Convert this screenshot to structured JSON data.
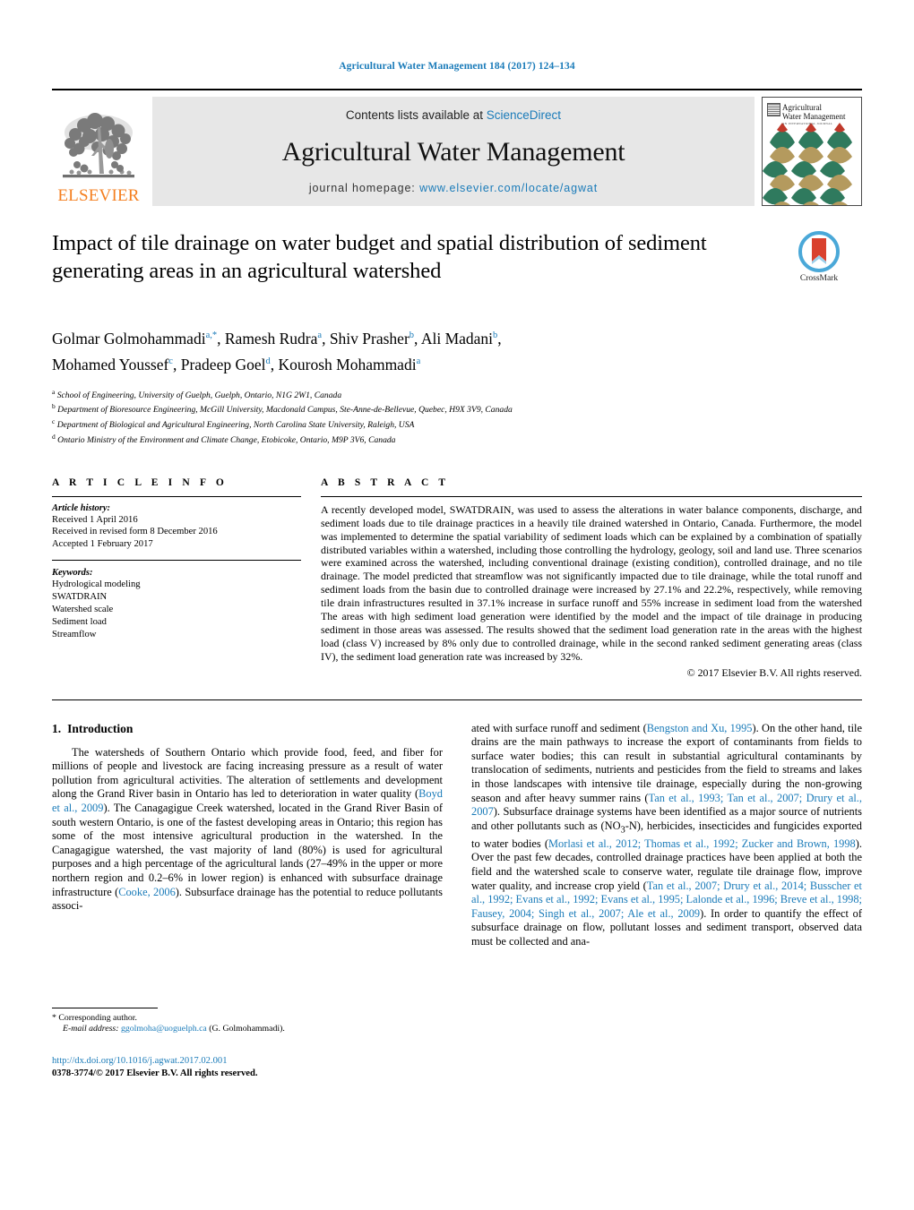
{
  "running_head": "Agricultural Water Management 184 (2017) 124–134",
  "masthead": {
    "elsevier_wordmark": "ELSEVIER",
    "contents_prefix": "Contents lists available at",
    "contents_link": "ScienceDirect",
    "journal_name": "Agricultural Water Management",
    "homepage_prefix": "journal homepage:",
    "homepage_link": "www.elsevier.com/locate/agwat",
    "cover_title_line1": "Agricultural",
    "cover_title_line2": "Water Management",
    "cover_subtitle": "AN INTERNATIONAL JOURNAL"
  },
  "article": {
    "title": "Impact of tile drainage on water budget and spatial distribution of sediment generating areas in an agricultural watershed",
    "crossmark_label": "CrossMark",
    "authors_line1_parts": [
      {
        "name": "Golmar Golmohammadi",
        "sup": "a,*"
      },
      {
        "name": "Ramesh Rudra",
        "sup": "a"
      },
      {
        "name": "Shiv Prasher",
        "sup": "b"
      },
      {
        "name": "Ali Madani",
        "sup": "b"
      }
    ],
    "authors_line2_parts": [
      {
        "name": "Mohamed Youssef",
        "sup": "c"
      },
      {
        "name": "Pradeep Goel",
        "sup": "d"
      },
      {
        "name": "Kourosh Mohammadi",
        "sup": "a"
      }
    ],
    "affiliations": [
      {
        "marker": "a",
        "text": "School of Engineering, University of Guelph, Guelph, Ontario, N1G 2W1, Canada"
      },
      {
        "marker": "b",
        "text": "Department of Bioresource Engineering, McGill University, Macdonald Campus, Ste-Anne-de-Bellevue, Quebec, H9X 3V9, Canada"
      },
      {
        "marker": "c",
        "text": "Department of Biological and Agricultural Engineering, North Carolina State University, Raleigh, USA"
      },
      {
        "marker": "d",
        "text": "Ontario Ministry of the Environment and Climate Change, Etobicoke, Ontario, M9P 3V6, Canada"
      }
    ]
  },
  "article_info": {
    "heading": "A R T I C L E    I N F O",
    "history_label": "Article history:",
    "history": [
      "Received 1 April 2016",
      "Received in revised form 8 December 2016",
      "Accepted 1 February 2017"
    ],
    "keywords_label": "Keywords:",
    "keywords": [
      "Hydrological modeling",
      "SWATDRAIN",
      "Watershed scale",
      "Sediment load",
      "Streamflow"
    ]
  },
  "abstract": {
    "heading": "A B S T R A C T",
    "text": "A recently developed model, SWATDRAIN, was used to assess the alterations in water balance components, discharge, and sediment loads due to tile drainage practices in a heavily tile drained watershed in Ontario, Canada. Furthermore, the model was implemented to determine the spatial variability of sediment loads which can be explained by a combination of spatially distributed variables within a watershed, including those controlling the hydrology, geology, soil and land use. Three scenarios were examined across the watershed, including conventional drainage (existing condition), controlled drainage, and no tile drainage. The model predicted that streamflow was not significantly impacted due to tile drainage, while the total runoff and sediment loads from the basin due to controlled drainage were increased by 27.1% and 22.2%, respectively, while removing tile drain infrastructures resulted in 37.1% increase in surface runoff and 55% increase in sediment load from the watershed The areas with high sediment load generation were identified by the model and the impact of tile drainage in producing sediment in those areas was assessed. The results showed that the sediment load generation rate in the areas with the highest load (class V) increased by 8% only due to controlled drainage, while in the second ranked sediment generating areas (class IV), the sediment load generation rate was increased by 32%.",
    "copyright": "© 2017 Elsevier B.V. All rights reserved."
  },
  "introduction": {
    "number": "1.",
    "heading": "Introduction",
    "left_paragraph_parts": [
      {
        "t": "The watersheds of Southern Ontario which provide food, feed, and fiber for millions of people and livestock are facing increasing pressure as a result of water pollution from agricultural activities. The alteration of settlements and development along the Grand River basin in Ontario has led to deterioration in water quality (",
        "k": "text"
      },
      {
        "t": "Boyd et al., 2009",
        "k": "cite"
      },
      {
        "t": "). The Canagagigue Creek watershed, located in the Grand River Basin of south western Ontario, is one of the fastest developing areas in Ontario; this region has some of the most intensive agricultural production in the watershed. In the Canagagigue watershed, the vast majority of land (80%) is used for agricultural purposes and a high percentage of the agricultural lands (27–49% in the upper or more northern region and 0.2–6% in lower region) is enhanced with subsurface drainage infrastructure (",
        "k": "text"
      },
      {
        "t": "Cooke, 2006",
        "k": "cite"
      },
      {
        "t": "). Subsurface drainage has the potential to reduce pollutants associ-",
        "k": "text"
      }
    ],
    "right_paragraph_parts": [
      {
        "t": "ated with surface runoff and sediment (",
        "k": "text"
      },
      {
        "t": "Bengston and Xu, 1995",
        "k": "cite"
      },
      {
        "t": "). On the other hand, tile drains are the main pathways to increase the export of contaminants from fields to surface water bodies; this can result in substantial agricultural contaminants by translocation of sediments, nutrients and pesticides from the field to streams and lakes in those landscapes with intensive tile drainage, especially during the non-growing season and after heavy summer rains (",
        "k": "text"
      },
      {
        "t": "Tan et al., 1993; Tan et al., 2007; Drury et al., 2007",
        "k": "cite"
      },
      {
        "t": "). Subsurface drainage systems have been identified as a major source of nutrients and other pollutants such as (NO",
        "k": "text"
      },
      {
        "t": "3",
        "k": "sub"
      },
      {
        "t": "-N), herbicides, insecticides and fungicides exported to water bodies (",
        "k": "text"
      },
      {
        "t": "Morlasi et al., 2012; Thomas et al., 1992; Zucker and Brown, 1998",
        "k": "cite"
      },
      {
        "t": "). Over the past few decades, controlled drainage practices have been applied at both the field and the watershed scale to conserve water, regulate tile drainage flow, improve water quality, and increase crop yield (",
        "k": "text"
      },
      {
        "t": "Tan et al., 2007; Drury et al., 2014; Busscher et al., 1992; Evans et al., 1992; Evans et al., 1995; Lalonde et al., 1996; Breve et al., 1998; Fausey, 2004; Singh et al., 2007; Ale et al., 2009",
        "k": "cite"
      },
      {
        "t": "). In order to quantify the effect of subsurface drainage on flow, pollutant losses and sediment transport, observed data must be collected and ana-",
        "k": "text"
      }
    ]
  },
  "footer": {
    "corresponding_marker": "*",
    "corresponding_label": "Corresponding author.",
    "email_label": "E-mail address:",
    "email": "ggolmoha@uoguelph.ca",
    "email_suffix": "(G. Golmohammadi).",
    "doi": "http://dx.doi.org/10.1016/j.agwat.2017.02.001",
    "issn_line": "0378-3774/© 2017 Elsevier B.V. All rights reserved."
  },
  "colors": {
    "link_blue": "#1A7BB9",
    "elsevier_orange": "#F47F20",
    "masthead_gray": "#E7E7E7",
    "cover_green": "#2F7A5E",
    "cover_tan": "#B49A5E",
    "cover_red": "#C0392B",
    "crossmark_blue": "#4AA8D8",
    "crossmark_red": "#D9412E"
  }
}
